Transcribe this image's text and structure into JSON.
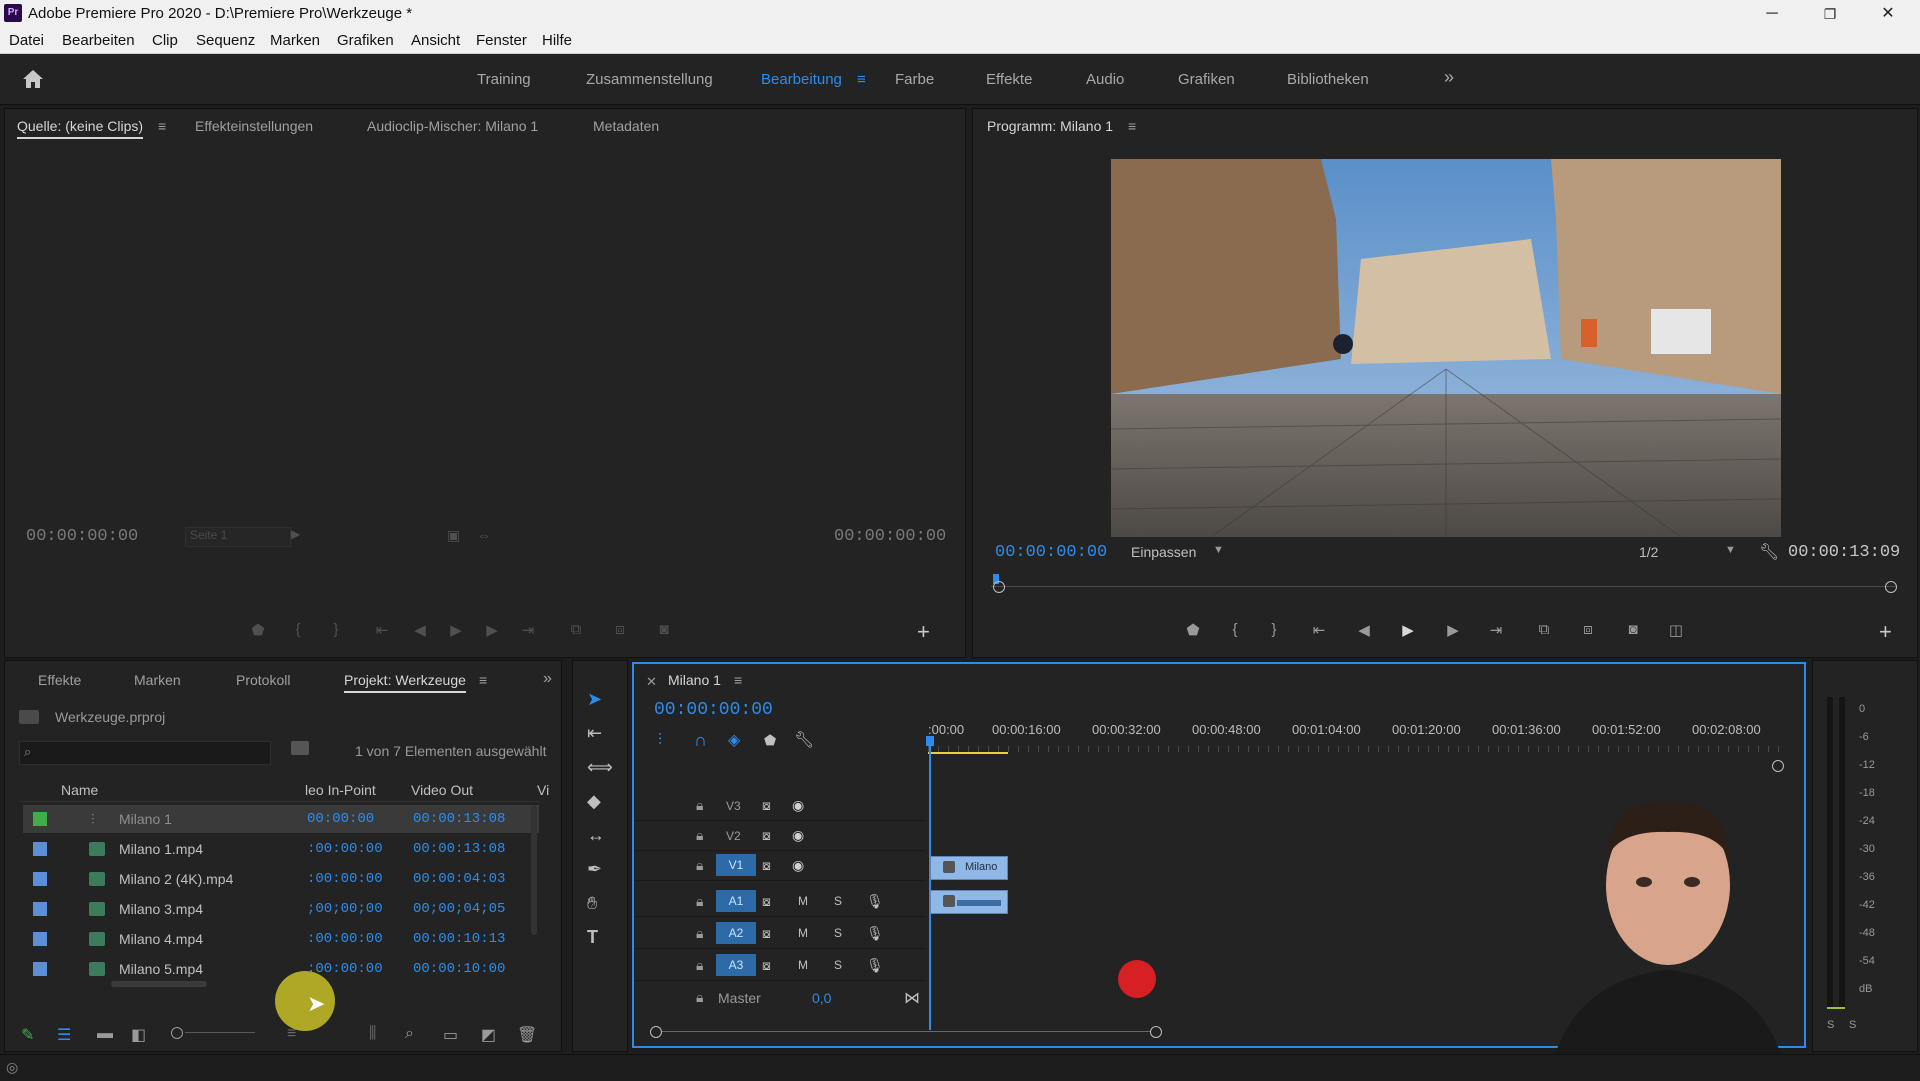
{
  "window": {
    "title": "Adobe Premiere Pro 2020 - D:\\Premiere Pro\\Werkzeuge *",
    "logo": "Pr",
    "minimize": "─",
    "maximize": "❐",
    "close": "✕"
  },
  "menu": [
    "Datei",
    "Bearbeiten",
    "Clip",
    "Sequenz",
    "Marken",
    "Grafiken",
    "Ansicht",
    "Fenster",
    "Hilfe"
  ],
  "workspaces": {
    "items": [
      "Training",
      "Zusammenstellung",
      "Bearbeitung",
      "Farbe",
      "Effekte",
      "Audio",
      "Grafiken",
      "Bibliotheken"
    ],
    "active": "Bearbeitung",
    "more": "»"
  },
  "source": {
    "tabs": [
      "Quelle: (keine Clips)",
      "Effekteinstellungen",
      "Audioclip-Mischer: Milano 1",
      "Metadaten"
    ],
    "tc_left": "00:00:00:00",
    "page_select": "Seite 1",
    "tc_right": "00:00:00:00"
  },
  "program": {
    "tab": "Programm: Milano 1",
    "tc_current": "00:00:00:00",
    "fit": "Einpassen",
    "resolution": "1/2",
    "tc_duration": "00:00:13:09"
  },
  "project_panel": {
    "tabs": [
      "Effekte",
      "Marken",
      "Protokoll",
      "Projekt: Werkzeuge"
    ],
    "file": "Werkzeuge.prproj",
    "search_placeholder": "",
    "selection_info": "1 von 7 Elementen ausgewählt",
    "columns": [
      "Name",
      "leo In-Point",
      "Video Out",
      "Vi"
    ],
    "rows": [
      {
        "name": "Milano 1",
        "in": "00:00:00",
        "out": "00:00:13:08",
        "color": "#3fae49"
      },
      {
        "name": "Milano 1.mp4",
        "in": ":00:00:00",
        "out": "00:00:13:08",
        "color": "#5b8fd6"
      },
      {
        "name": "Milano 2 (4K).mp4",
        "in": ":00:00:00",
        "out": "00:00:04:03",
        "color": "#5b8fd6"
      },
      {
        "name": "Milano 3.mp4",
        "in": ";00;00;00",
        "out": "00;00;04;05",
        "color": "#5b8fd6"
      },
      {
        "name": "Milano 4.mp4",
        "in": ":00:00:00",
        "out": "00:00:10:13",
        "color": "#5b8fd6"
      },
      {
        "name": "Milano 5.mp4",
        "in": ":00:00:00",
        "out": "00:00:10:00",
        "color": "#5b8fd6"
      }
    ]
  },
  "timeline": {
    "tab": "Milano 1",
    "tc": "00:00:00:00",
    "ruler": [
      ":00:00",
      "00:00:16:00",
      "00:00:32:00",
      "00:00:48:00",
      "00:01:04:00",
      "00:01:20:00",
      "00:01:36:00",
      "00:01:52:00",
      "00:02:08:00"
    ],
    "video_tracks": [
      "V3",
      "V2",
      "V1"
    ],
    "audio_tracks": [
      "A1",
      "A2",
      "A3"
    ],
    "mute": "M",
    "solo": "S",
    "master_label": "Master",
    "master_value": "0,0",
    "clip_label": "Milano"
  },
  "meter": {
    "labels": [
      "0",
      "-6",
      "-12",
      "-18",
      "-24",
      "-30",
      "-36",
      "-42",
      "-48",
      "-54",
      "dB"
    ],
    "solo_left": "S",
    "solo_right": "S"
  }
}
